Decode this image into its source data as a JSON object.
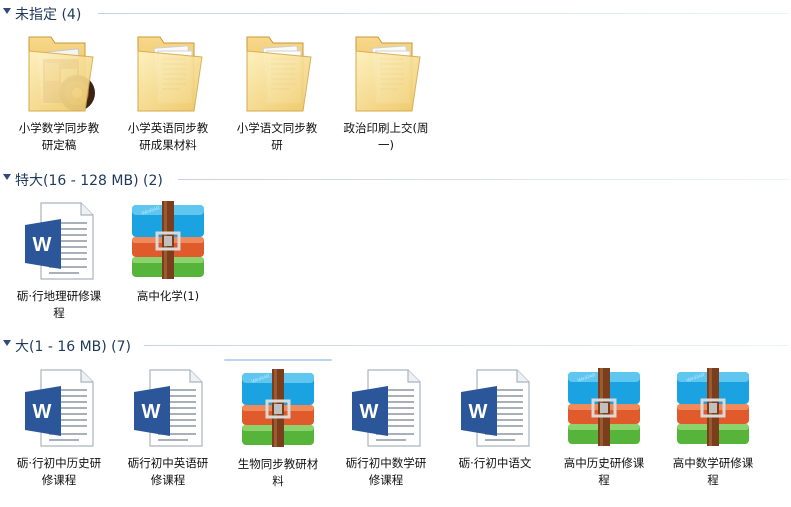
{
  "groups": [
    {
      "header": "未指定 (4)",
      "items": [
        {
          "name": "小学数学同步教研定稿",
          "label": "小学数学同步教\n研定稿",
          "icon": "folder-with-photo-icon",
          "type": "folder"
        },
        {
          "name": "小学英语同步教研成果材料",
          "label": "小学英语同步教\n研成果材料",
          "icon": "folder-icon",
          "type": "folder"
        },
        {
          "name": "小学语文同步教研",
          "label": "小学语文同步教\n研",
          "icon": "folder-icon",
          "type": "folder"
        },
        {
          "name": "政治印刷上交(周一)",
          "label": "政治印刷上交(周\n一)",
          "icon": "folder-icon",
          "type": "folder"
        }
      ]
    },
    {
      "header": "特大(16 - 128 MB) (2)",
      "items": [
        {
          "name": "砺·行地理研修课程",
          "label": "砺·行地理研修课\n程",
          "icon": "word-document-icon",
          "type": "word"
        },
        {
          "name": "高中化学(1)",
          "label": "高中化学(1)",
          "icon": "winrar-archive-icon",
          "type": "rar"
        }
      ]
    },
    {
      "header": "大(1 - 16 MB) (7)",
      "items": [
        {
          "name": "砺·行初中历史研修课程",
          "label": "砺·行初中历史研\n修课程",
          "icon": "word-document-icon",
          "type": "word"
        },
        {
          "name": "砺行初中英语研修课程",
          "label": "砺行初中英语研\n修课程",
          "icon": "word-document-icon",
          "type": "word"
        },
        {
          "name": "生物同步教研材料",
          "label": "生物同步教研材\n料",
          "icon": "winrar-archive-icon",
          "type": "rar",
          "selected": true
        },
        {
          "name": "砺行初中数学研修课程",
          "label": "砺行初中数学研\n修课程",
          "icon": "word-document-icon",
          "type": "word"
        },
        {
          "name": "砺·行初中语文",
          "label": "砺·行初中语文",
          "icon": "word-document-icon",
          "type": "word"
        },
        {
          "name": "高中历史研修课程",
          "label": "高中历史研修课\n程",
          "icon": "winrar-archive-icon",
          "type": "rar"
        },
        {
          "name": "高中数学研修课程",
          "label": "高中数学研修课\n程",
          "icon": "winrar-archive-icon",
          "type": "rar"
        }
      ]
    }
  ]
}
